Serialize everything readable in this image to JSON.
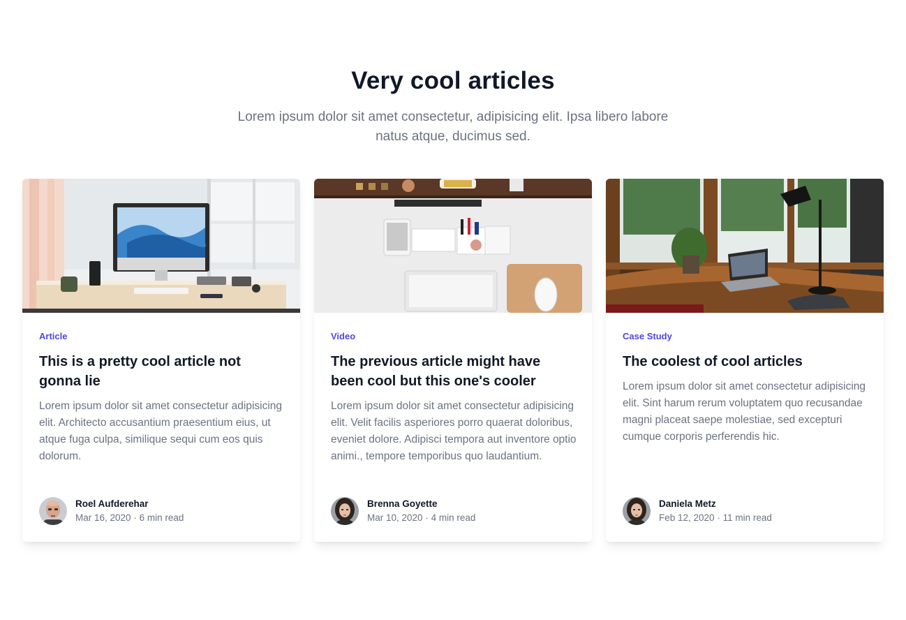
{
  "header": {
    "title": "Very cool articles",
    "subtitle": "Lorem ipsum dolor sit amet consectetur, adipisicing elit. Ipsa libero labore natus atque, ducimus sed."
  },
  "articles": [
    {
      "category": "Article",
      "title": "This is a pretty cool article not gonna lie",
      "description": "Lorem ipsum dolor sit amet consectetur adipisicing elit. Architecto accusantium praesentium eius, ut atque fuga culpa, similique sequi cum eos quis dolorum.",
      "author": "Roel Aufderehar",
      "date": "Mar 16, 2020",
      "read_time": "6 min read",
      "image": "desk-with-imac-photo",
      "avatar": "bald-man-avatar"
    },
    {
      "category": "Video",
      "title": "The previous article might have been cool but this one's cooler",
      "description": "Lorem ipsum dolor sit amet consectetur adipisicing elit. Velit facilis asperiores porro quaerat doloribus, eveniet dolore. Adipisci tempora aut inventore optio animi., tempore temporibus quo laudantium.",
      "author": "Brenna Goyette",
      "date": "Mar 10, 2020",
      "read_time": "4 min read",
      "image": "top-down-desk-photo",
      "avatar": "woman-avatar"
    },
    {
      "category": "Case Study",
      "title": "The coolest of cool articles",
      "description": "Lorem ipsum dolor sit amet consectetur adipisicing elit. Sint harum rerum voluptatem quo recusandae magni placeat saepe molestiae, sed excepturi cumque corporis perferendis hic.",
      "author": "Daniela Metz",
      "date": "Feb 12, 2020",
      "read_time": "11 min read",
      "image": "cabin-laptop-photo",
      "avatar": "woman-avatar"
    }
  ],
  "colors": {
    "accent": "#4f46e5",
    "heading": "#111827",
    "muted": "#6b7280"
  }
}
